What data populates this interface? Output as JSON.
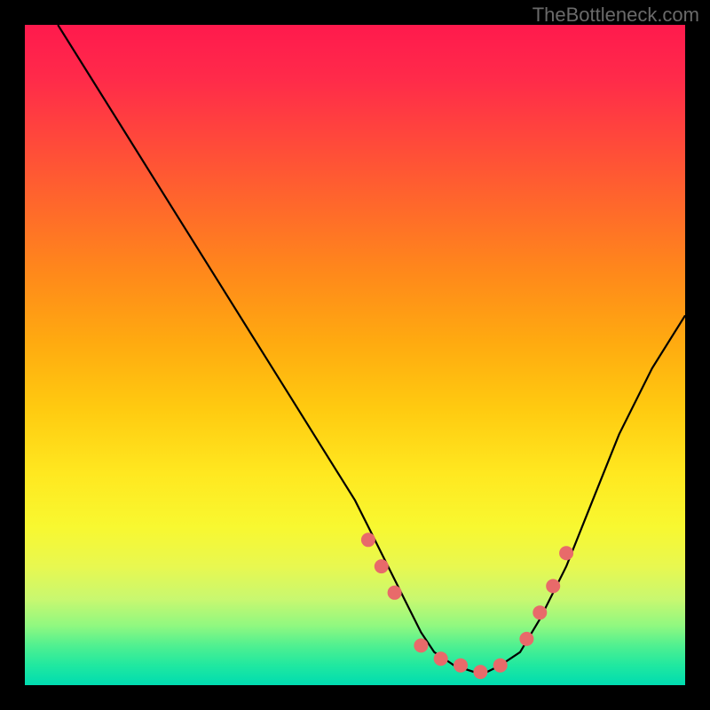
{
  "watermark": "TheBottleneck.com",
  "chart_data": {
    "type": "line",
    "title": "",
    "xlabel": "",
    "ylabel": "",
    "xlim": [
      0,
      100
    ],
    "ylim": [
      0,
      100
    ],
    "series": [
      {
        "name": "curve",
        "x": [
          5,
          10,
          15,
          20,
          25,
          30,
          35,
          40,
          45,
          50,
          52,
          55,
          58,
          60,
          62,
          65,
          68,
          70,
          72,
          75,
          78,
          82,
          86,
          90,
          95,
          100
        ],
        "y": [
          100,
          92,
          84,
          76,
          68,
          60,
          52,
          44,
          36,
          28,
          24,
          18,
          12,
          8,
          5,
          3,
          2,
          2,
          3,
          5,
          10,
          18,
          28,
          38,
          48,
          56
        ]
      }
    ],
    "markers": {
      "name": "dots",
      "color": "#e86a6a",
      "x": [
        52,
        54,
        56,
        60,
        63,
        66,
        69,
        72,
        76,
        78,
        80,
        82
      ],
      "y": [
        22,
        18,
        14,
        6,
        4,
        3,
        2,
        3,
        7,
        11,
        15,
        20
      ]
    }
  }
}
